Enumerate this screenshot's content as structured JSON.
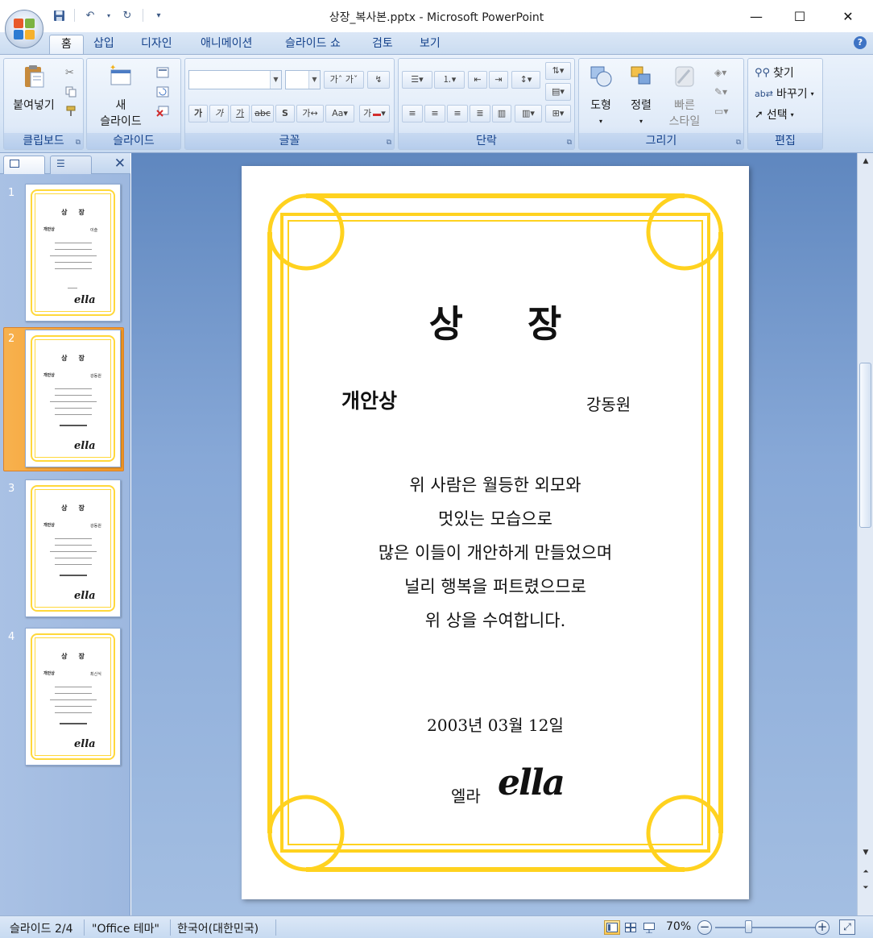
{
  "window": {
    "title": "상장_복사본.pptx - Microsoft PowerPoint",
    "minimize_glyph": "—",
    "maximize_glyph": "☐",
    "close_glyph": "✕"
  },
  "ribbon_tabs": [
    "홈",
    "삽입",
    "디자인",
    "애니메이션",
    "슬라이드 쇼",
    "검토",
    "보기"
  ],
  "ribbon": {
    "clipboard": {
      "label": "클립보드",
      "paste": "붙여넣기"
    },
    "slides": {
      "label": "슬라이드",
      "new_slide_line1": "새",
      "new_slide_line2": "슬라이드"
    },
    "font": {
      "label": "글꼴",
      "font_name": "",
      "font_size": ""
    },
    "paragraph": {
      "label": "단락"
    },
    "drawing": {
      "label": "그리기",
      "shapes": "도형",
      "arrange": "정렬",
      "quick_styles_line1": "빠른",
      "quick_styles_line2": "스타일"
    },
    "editing": {
      "label": "편집",
      "find": "찾기",
      "replace": "바꾸기",
      "select": "선택"
    }
  },
  "slide_panel": {
    "thumbnails": [
      {
        "number": "1",
        "recipient": "이슬",
        "has_date": false
      },
      {
        "number": "2",
        "recipient": "강동원",
        "has_date": true
      },
      {
        "number": "3",
        "recipient": "강동원",
        "has_date": true
      },
      {
        "number": "4",
        "recipient": "최신식",
        "has_date": true
      }
    ],
    "selected_index": 2
  },
  "slide": {
    "title": "상     장",
    "award": "개안상",
    "recipient": "강동원",
    "body_lines": [
      "위 사람은 월등한 외모와",
      "멋있는 모습으로",
      "많은 이들이 개안하게 만들었으며",
      "널리 행복을 퍼트렸으므로",
      "위 상을 수여합니다."
    ],
    "date": "2003년 03월 12일",
    "signer": "엘라",
    "signature": "ella"
  },
  "status": {
    "slide_indicator": "슬라이드 2/4",
    "theme": "\"Office 테마\"",
    "language": "한국어(대한민국)",
    "zoom": "70%"
  },
  "colors": {
    "frame_yellow": "#ffd21f",
    "accent_orange": "#f59a25",
    "ribbon_blue": "#15428b"
  }
}
